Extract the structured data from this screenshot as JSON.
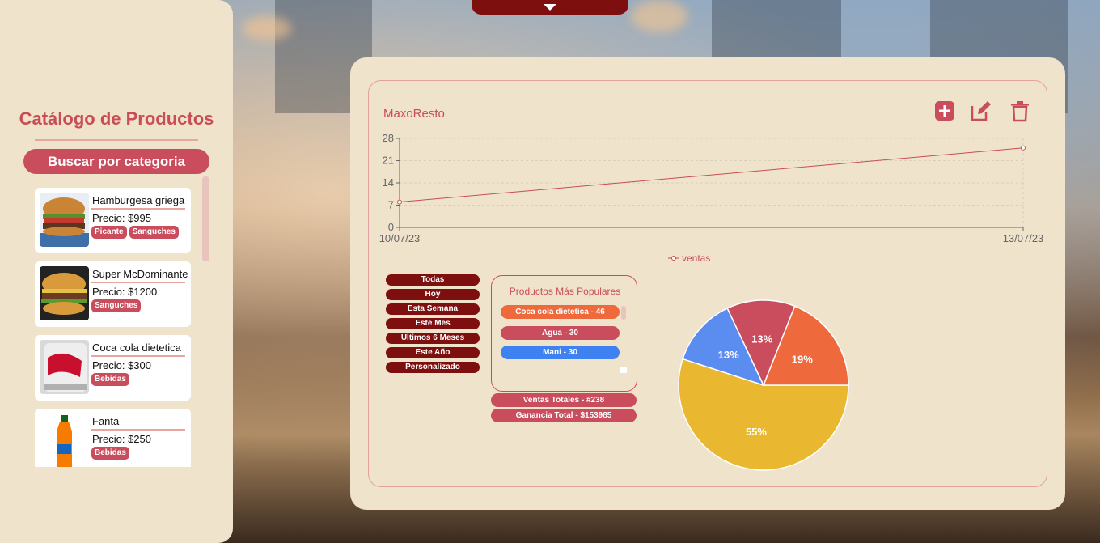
{
  "sidebar": {
    "title": "Catálogo de Productos",
    "category_button": "Buscar por categoria",
    "products": [
      {
        "name": "Hamburgesa griega",
        "price": "Precio: $995",
        "tags": [
          "Picante",
          "Sanguches"
        ],
        "image": "burger"
      },
      {
        "name": "Super McDominante",
        "price": "Precio: $1200",
        "tags": [
          "Sanguches"
        ],
        "image": "burger-2"
      },
      {
        "name": "Coca cola dietetica",
        "price": "Precio: $300",
        "tags": [
          "Bebidas"
        ],
        "image": "diet-coke-can"
      },
      {
        "name": "Fanta",
        "price": "Precio: $250",
        "tags": [
          "Bebidas"
        ],
        "image": "fanta-bottle"
      }
    ]
  },
  "panel": {
    "title": "MaxoResto",
    "icons": [
      "add-icon",
      "edit-icon",
      "delete-icon"
    ]
  },
  "chart_data": [
    {
      "type": "line",
      "x": [
        "10/07/23",
        "13/07/23"
      ],
      "series": [
        {
          "name": "ventas",
          "values": [
            8,
            25
          ]
        }
      ],
      "ylim": [
        0,
        28
      ],
      "yticks": [
        0,
        7,
        14,
        21,
        28
      ],
      "legend": "bottom",
      "grid": true,
      "colors": {
        "line": "#c94d55"
      }
    },
    {
      "type": "pie",
      "slices": [
        {
          "value": 55,
          "label": "55%",
          "color": "#e9b830"
        },
        {
          "value": 13,
          "label": "13%",
          "color": "#5b8cf0"
        },
        {
          "value": 13,
          "label": "13%",
          "color": "#c94d5d"
        },
        {
          "value": 19,
          "label": "19%",
          "color": "#ee6a3c"
        }
      ]
    }
  ],
  "filters": [
    "Todas",
    "Hoy",
    "Esta Semana",
    "Este Mes",
    "Ultimos 6 Meses",
    "Este Año",
    "Personalizado"
  ],
  "popular": {
    "title": "Productos Más Populares",
    "items": [
      {
        "label": "Coca cola dietetica - 46",
        "color": "#ee6a3c"
      },
      {
        "label": "Agua - 30",
        "color": "#c94d5d"
      },
      {
        "label": "Mani - 30",
        "color": "#3d82f0"
      }
    ]
  },
  "stats": {
    "total_sales": "Ventas Totales - #238",
    "total_profit": "Ganancia Total - $153985"
  }
}
